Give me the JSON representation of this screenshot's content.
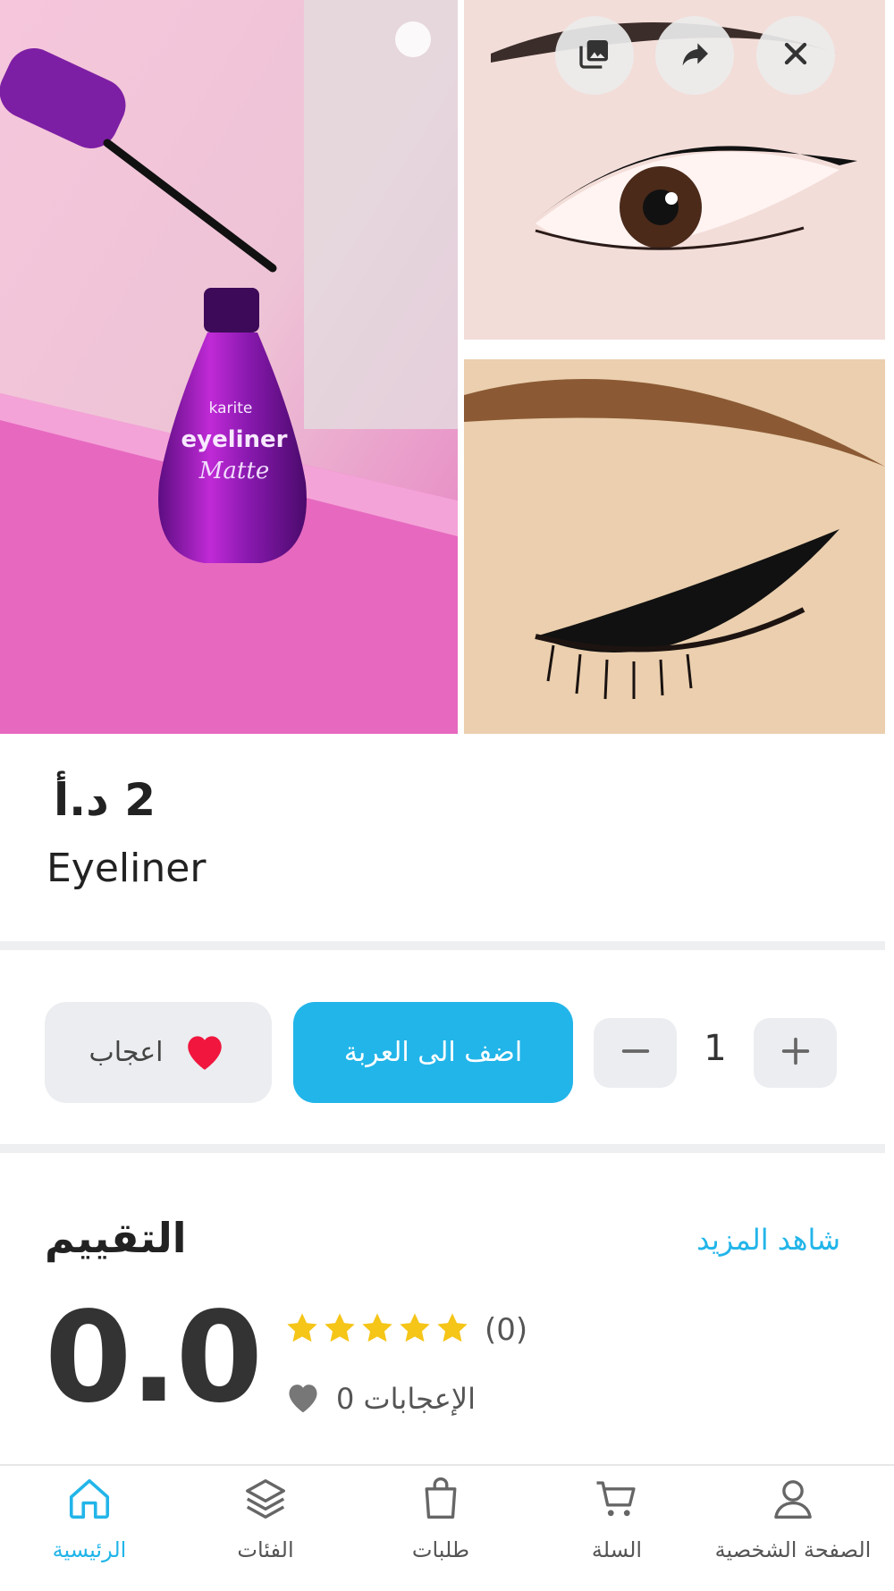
{
  "product": {
    "price": "2 د.أ",
    "name": "Eyeliner",
    "image_brand_text": "karite eyeliner Matte"
  },
  "hero_actions": {
    "gallery_icon": "gallery-icon",
    "share_icon": "share-icon",
    "close_icon": "close-icon"
  },
  "actions": {
    "like_label": "اعجاب",
    "add_to_cart_label": "اضف الى العربة",
    "quantity": "1"
  },
  "rating": {
    "title": "التقييم",
    "see_more": "شاهد المزيد",
    "value": "0.0",
    "stars": 5,
    "count": "(0)",
    "likes": "0 الإعجابات"
  },
  "nav": {
    "items": [
      {
        "label": "الرئيسية",
        "icon": "home-icon",
        "active": true
      },
      {
        "label": "الفئات",
        "icon": "layers-icon",
        "active": false
      },
      {
        "label": "طلبات",
        "icon": "shopping-bag-icon",
        "active": false
      },
      {
        "label": "السلة",
        "icon": "cart-icon",
        "active": false
      },
      {
        "label": "الصفحة الشخصية",
        "icon": "user-icon",
        "active": false
      }
    ]
  },
  "colors": {
    "accent": "#22b5e9",
    "heart": "#f0163e",
    "star": "#f5c518",
    "button_bg": "#ebedf0"
  }
}
